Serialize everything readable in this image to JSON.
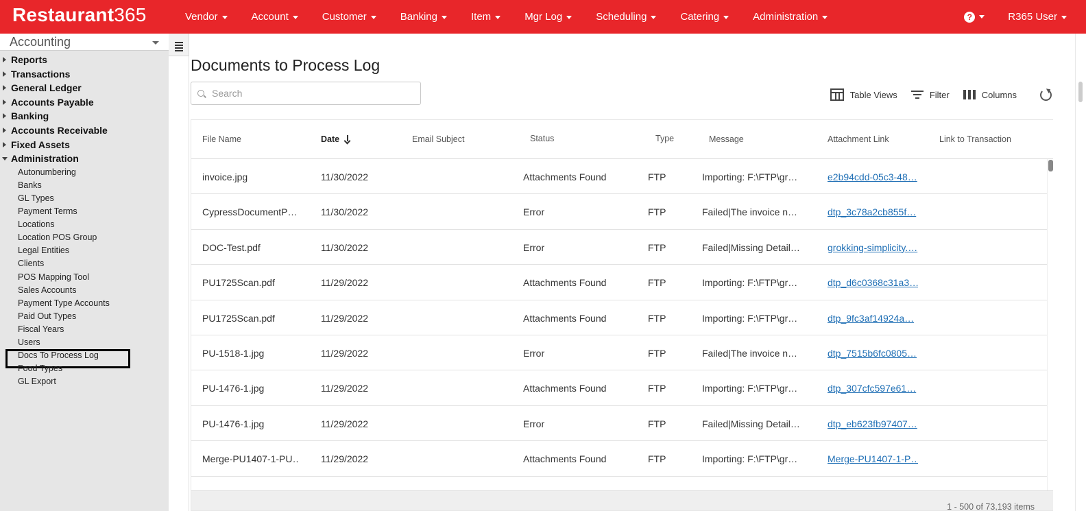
{
  "brand": {
    "name_part1": "Restaurant",
    "name_part2": "365"
  },
  "nav": [
    "Vendor",
    "Account",
    "Customer",
    "Banking",
    "Item",
    "Mgr Log",
    "Scheduling",
    "Catering",
    "Administration"
  ],
  "help_label": "?",
  "user": "R365 User",
  "sidebar": {
    "module": "Accounting",
    "sections": [
      {
        "label": "Reports",
        "expanded": false
      },
      {
        "label": "Transactions",
        "expanded": false
      },
      {
        "label": "General Ledger",
        "expanded": false
      },
      {
        "label": "Accounts Payable",
        "expanded": false
      },
      {
        "label": "Banking",
        "expanded": false
      },
      {
        "label": "Accounts Receivable",
        "expanded": false
      },
      {
        "label": "Fixed Assets",
        "expanded": false
      },
      {
        "label": "Administration",
        "expanded": true
      }
    ],
    "admin_items": [
      "Autonumbering",
      "Banks",
      "GL Types",
      "Payment Terms",
      "Locations",
      "Location POS Group",
      "Legal Entities",
      "Clients",
      "POS Mapping Tool",
      "Sales Accounts",
      "Payment Type Accounts",
      "Paid Out Types",
      "Fiscal Years",
      "Users",
      "Docs To Process Log",
      "Food Types",
      "GL Export"
    ],
    "active_item": "Docs To Process Log"
  },
  "page": {
    "title": "Documents to Process Log",
    "search_placeholder": "Search",
    "toolbar": {
      "table_views": "Table Views",
      "filter": "Filter",
      "columns": "Columns"
    }
  },
  "table": {
    "headers": [
      "File Name",
      "Date",
      "Email Subject",
      "Status",
      "Type",
      "Message",
      "Attachment Link",
      "Link to Transaction"
    ],
    "sorted_column": "Date",
    "rows": [
      {
        "file": "invoice.jpg",
        "date": "11/30/2022",
        "subject": "",
        "status": "Attachments Found",
        "type": "FTP",
        "message": "Importing: F:\\FTP\\gr…",
        "link": "e2b94cdd-05c3-48…"
      },
      {
        "file": "CypressDocumentP…",
        "date": "11/30/2022",
        "subject": "",
        "status": "Error",
        "type": "FTP",
        "message": "Failed|The invoice n…",
        "link": "dtp_3c78a2cb855f…"
      },
      {
        "file": "DOC-Test.pdf",
        "date": "11/30/2022",
        "subject": "",
        "status": "Error",
        "type": "FTP",
        "message": "Failed|Missing Detail…",
        "link": "grokking-simplicity.…"
      },
      {
        "file": "PU1725Scan.pdf",
        "date": "11/29/2022",
        "subject": "",
        "status": "Attachments Found",
        "type": "FTP",
        "message": "Importing: F:\\FTP\\gr…",
        "link": "dtp_d6c0368c31a3…"
      },
      {
        "file": "PU1725Scan.pdf",
        "date": "11/29/2022",
        "subject": "",
        "status": "Attachments Found",
        "type": "FTP",
        "message": "Importing: F:\\FTP\\gr…",
        "link": "dtp_9fc3af14924a…"
      },
      {
        "file": "PU-1518-1.jpg",
        "date": "11/29/2022",
        "subject": "",
        "status": "Error",
        "type": "FTP",
        "message": "Failed|The invoice n…",
        "link": "dtp_7515b6fc0805…"
      },
      {
        "file": "PU-1476-1.jpg",
        "date": "11/29/2022",
        "subject": "",
        "status": "Attachments Found",
        "type": "FTP",
        "message": "Importing: F:\\FTP\\gr…",
        "link": "dtp_307cfc597e61…"
      },
      {
        "file": "PU-1476-1.jpg",
        "date": "11/29/2022",
        "subject": "",
        "status": "Error",
        "type": "FTP",
        "message": "Failed|Missing Detail…",
        "link": "dtp_eb623fb97407…"
      },
      {
        "file": "Merge-PU1407-1-PU…",
        "date": "11/29/2022",
        "subject": "",
        "status": "Attachments Found",
        "type": "FTP",
        "message": "Importing: F:\\FTP\\gr…",
        "link": "Merge-PU1407-1-P…"
      },
      {
        "file": "",
        "date": "",
        "subject": "",
        "status": "",
        "type": "",
        "message": "",
        "link": ""
      }
    ],
    "pager": "1 - 500 of 73,193 items"
  }
}
